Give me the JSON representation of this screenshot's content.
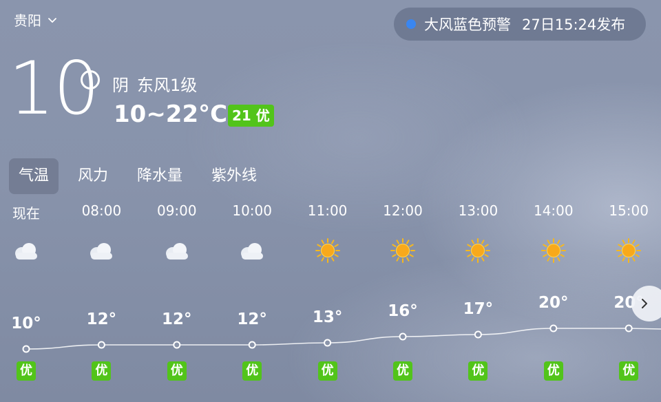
{
  "location": {
    "city": "贵阳"
  },
  "alert": {
    "text": "大风蓝色预警",
    "time": "27日15:24发布",
    "dot_color": "#3a86f0"
  },
  "current": {
    "temperature": "10",
    "condition": "阴",
    "wind": "东风1级",
    "range": "10~22°C",
    "aqi": "21 优",
    "aqi_color": "#52c41a"
  },
  "tabs": [
    {
      "label": "气温",
      "active": true
    },
    {
      "label": "风力",
      "active": false
    },
    {
      "label": "降水量",
      "active": false
    },
    {
      "label": "紫外线",
      "active": false
    }
  ],
  "hourly": [
    {
      "time": "现在",
      "icon": "cloudy-icon",
      "temp": "10°",
      "temp_value": 10,
      "quality": "优"
    },
    {
      "time": "08:00",
      "icon": "cloudy-icon",
      "temp": "12°",
      "temp_value": 12,
      "quality": "优"
    },
    {
      "time": "09:00",
      "icon": "cloudy-icon",
      "temp": "12°",
      "temp_value": 12,
      "quality": "优"
    },
    {
      "time": "10:00",
      "icon": "cloudy-icon",
      "temp": "12°",
      "temp_value": 12,
      "quality": "优"
    },
    {
      "time": "11:00",
      "icon": "sunny-icon",
      "temp": "13°",
      "temp_value": 13,
      "quality": "优"
    },
    {
      "time": "12:00",
      "icon": "sunny-icon",
      "temp": "16°",
      "temp_value": 16,
      "quality": "优"
    },
    {
      "time": "13:00",
      "icon": "sunny-icon",
      "temp": "17°",
      "temp_value": 17,
      "quality": "优"
    },
    {
      "time": "14:00",
      "icon": "sunny-icon",
      "temp": "20°",
      "temp_value": 20,
      "quality": "优"
    },
    {
      "time": "15:00",
      "icon": "sunny-icon",
      "temp": "20°",
      "temp_value": 20,
      "quality": "优"
    }
  ]
}
